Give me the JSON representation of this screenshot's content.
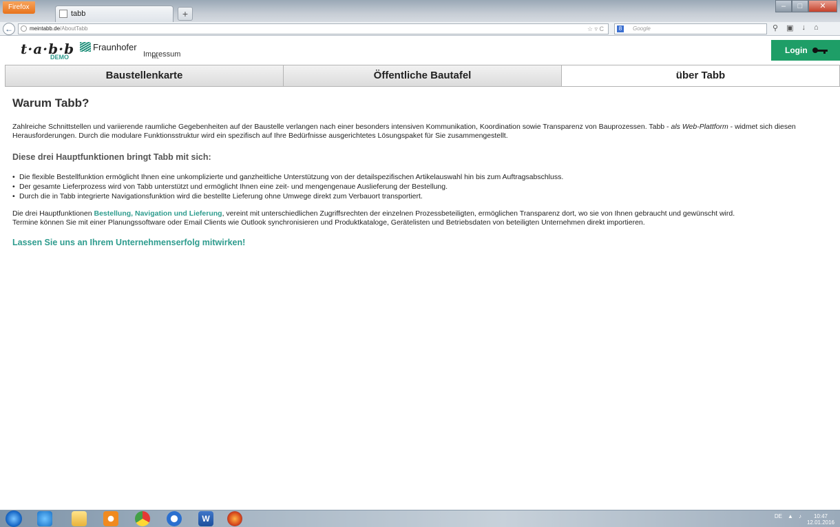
{
  "browser": {
    "menu_label": "Firefox",
    "tab_title": "tabb",
    "newtab_symbol": "+",
    "url_domain": "meintabb.de",
    "url_path": "/AboutTabb",
    "url_controls": "☆ ▿ C",
    "search_placeholder": "Google",
    "search_engine_icon": "8",
    "win_min": "–",
    "win_max": "□",
    "win_close": "✕"
  },
  "header": {
    "logo_text": "t·a·b·b",
    "logo_demo": "DEMO",
    "partner_name": "Fraunhofer",
    "partner_sub": "IML",
    "impressum": "Impressum",
    "login_label": "Login"
  },
  "nav": {
    "tabs": [
      {
        "label": "Baustellenkarte"
      },
      {
        "label": "Öffentliche Bautafel"
      },
      {
        "label": "über Tabb"
      }
    ]
  },
  "content": {
    "heading": "Warum Tabb?",
    "intro_1": "Zahlreiche Schnittstellen und variierende raumliche Gegebenheiten auf der Baustelle verlangen nach einer besonders intensiven Kommunikation, Koordination sowie Transparenz von Bauprozessen. Tabb - ",
    "intro_em": "als Web-Plattform",
    "intro_2": " - widmet sich diesen Herausforderungen. Durch die modulare Funktionsstruktur wird ein spezifisch auf Ihre Bedürfnisse ausgerichtetes Lösungspaket für Sie zusammengestellt.",
    "subheading": "Diese drei Hauptfunktionen bringt Tabb mit sich:",
    "bullets": [
      "Die flexible Bestellfunktion ermöglicht Ihnen eine unkomplizierte und ganzheitliche Unterstützung von der detailspezifischen Artikelauswahl hin bis zum Auftragsabschluss.",
      "Der gesamte Lieferprozess wird von Tabb unterstützt und ermöglicht Ihnen eine zeit- und mengengenaue Auslieferung der Bestellung.",
      "Durch die in Tabb integrierte Navigationsfunktion wird die bestellte Lieferung ohne Umwege direkt zum Verbauort transportiert."
    ],
    "para2_start": "Die drei Hauptfunktionen ",
    "para2_highlight": "Bestellung, Navigation und Lieferung",
    "para2_end": ", vereint mit unterschiedlichen Zugriffsrechten der einzelnen Prozessbeteiligten, ermöglichen Transparenz dort, wo sie von Ihnen gebraucht und gewünscht wird.",
    "para3": "Termine können Sie mit einer Planungssoftware oder Email Clients wie Outlook synchronisieren und Produktkataloge, Gerätelisten und Betriebsdaten von beteiligten Unternehmen direkt importieren.",
    "cta": "Lassen Sie uns an Ihrem Unternehmenserfolg mitwirken!"
  },
  "taskbar": {
    "lang": "DE",
    "time": "10:47",
    "date": "12.01.2016"
  },
  "colors": {
    "accent": "#2e9c8e",
    "login_bg": "#1e9e67"
  }
}
